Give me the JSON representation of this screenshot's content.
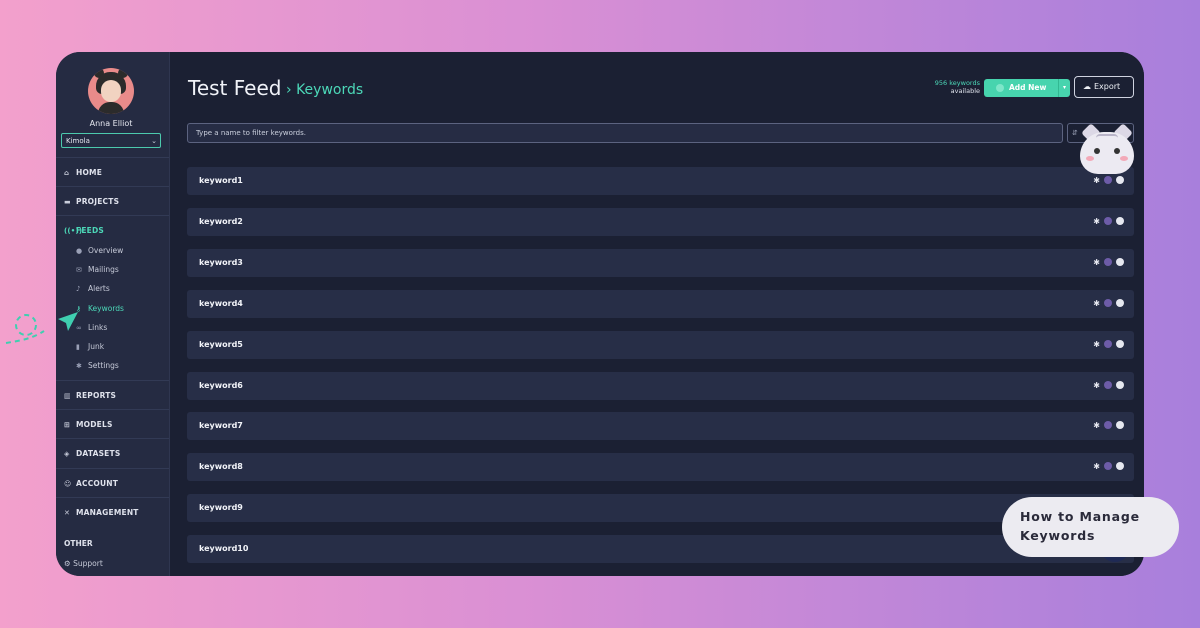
{
  "user": {
    "name": "Anna Elliot",
    "workspace": "Kimola"
  },
  "sidebar": {
    "sections": [
      {
        "key": "home",
        "label": "HOME",
        "icon": "home-icon"
      },
      {
        "key": "projects",
        "label": "PROJECTS",
        "icon": "folder-icon"
      },
      {
        "key": "feeds",
        "label": "FEEDS",
        "icon": "broadcast-icon",
        "active": true
      },
      {
        "key": "reports",
        "label": "REPORTS",
        "icon": "bar-chart-icon"
      },
      {
        "key": "models",
        "label": "MODELS",
        "icon": "grid-icon"
      },
      {
        "key": "datasets",
        "label": "DATASETS",
        "icon": "layers-icon"
      },
      {
        "key": "account",
        "label": "ACCOUNT",
        "icon": "user-gear-icon"
      },
      {
        "key": "management",
        "label": "MANAGEMENT",
        "icon": "tools-icon"
      }
    ],
    "feed_items": [
      {
        "label": "Overview",
        "icon": "chat-icon"
      },
      {
        "label": "Mailings",
        "icon": "mail-icon"
      },
      {
        "label": "Alerts",
        "icon": "bell-icon"
      },
      {
        "label": "Keywords",
        "icon": "key-icon",
        "active": true
      },
      {
        "label": "Links",
        "icon": "link-icon"
      },
      {
        "label": "Junk",
        "icon": "trash-icon"
      },
      {
        "label": "Settings",
        "icon": "gear-icon"
      }
    ],
    "other_label": "OTHER",
    "support_label": "Support"
  },
  "header": {
    "title": "Test Feed",
    "crumb": "Keywords",
    "count_value": "956 keywords",
    "count_suffix": "available",
    "add_label": "Add New",
    "export_label": "Export"
  },
  "filter": {
    "placeholder": "Type a name to filter keywords."
  },
  "keywords": [
    "keyword1",
    "keyword2",
    "keyword3",
    "keyword4",
    "keyword5",
    "keyword6",
    "keyword7",
    "keyword8",
    "keyword9",
    "keyword10"
  ],
  "overlay": {
    "bubble_text": "How to Manage Keywords"
  },
  "colors": {
    "accent": "#4cd8b8",
    "sidebar": "#252b42",
    "main": "#1b2033",
    "row": "#272e47"
  }
}
